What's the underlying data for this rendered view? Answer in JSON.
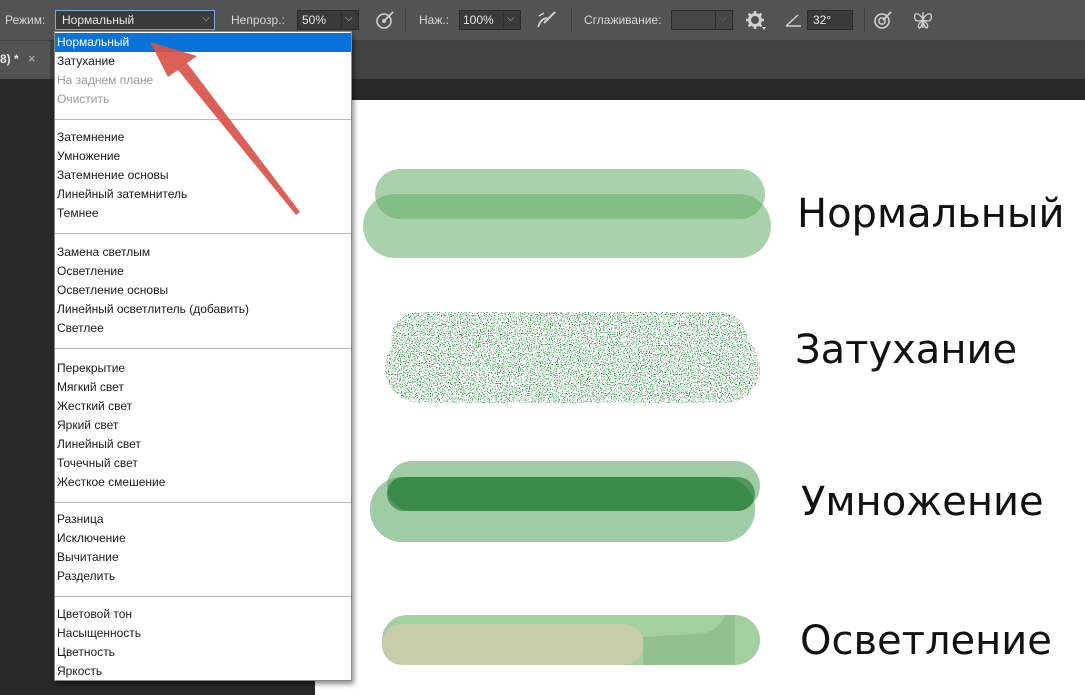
{
  "options_bar": {
    "mode_label": "Режим:",
    "mode_value": "Нормальный",
    "opacity_label": "Непрозр.:",
    "opacity_value": "50%",
    "pressure_label": "Наж.:",
    "pressure_value": "100%",
    "smoothing_label": "Сглаживание:",
    "smoothing_value": "",
    "angle_value": "32°"
  },
  "document_tab": {
    "title": "8) *",
    "close": "×"
  },
  "blend_menu": {
    "groups": [
      {
        "items": [
          {
            "label": "Нормальный",
            "state": "selected"
          },
          {
            "label": "Затухание",
            "state": "enabled"
          },
          {
            "label": "На заднем плане",
            "state": "disabled"
          },
          {
            "label": "Очистить",
            "state": "disabled"
          }
        ]
      },
      {
        "items": [
          {
            "label": "Затемнение"
          },
          {
            "label": "Умножение"
          },
          {
            "label": "Затемнение основы"
          },
          {
            "label": "Линейный затемнитель"
          },
          {
            "label": "Темнее"
          }
        ]
      },
      {
        "items": [
          {
            "label": "Замена светлым"
          },
          {
            "label": "Осветление"
          },
          {
            "label": "Осветление основы"
          },
          {
            "label": "Линейный осветлитель (добавить)"
          },
          {
            "label": "Светлее"
          }
        ]
      },
      {
        "items": [
          {
            "label": "Перекрытие"
          },
          {
            "label": "Мягкий свет"
          },
          {
            "label": "Жесткий свет"
          },
          {
            "label": "Яркий свет"
          },
          {
            "label": "Линейный свет"
          },
          {
            "label": "Точечный свет"
          },
          {
            "label": "Жесткое смешение"
          }
        ]
      },
      {
        "items": [
          {
            "label": "Разница"
          },
          {
            "label": "Исключение"
          },
          {
            "label": "Вычитание"
          },
          {
            "label": "Разделить"
          }
        ]
      },
      {
        "items": [
          {
            "label": "Цветовой тон"
          },
          {
            "label": "Насыщенность"
          },
          {
            "label": "Цветность"
          },
          {
            "label": "Яркость"
          }
        ]
      }
    ]
  },
  "canvas_labels": {
    "normal": "Нормальный",
    "dissolve": "Затухание",
    "multiply": "Умножение",
    "color_dodge": "Осветление"
  },
  "colors": {
    "selection": "#0a73d9",
    "stroke_green": "#62ad68",
    "annotation_arrow": "#d9534a"
  },
  "icons": [
    "airbrush-pressure-icon",
    "pressure-opacity-icon",
    "gear-icon",
    "angle-icon",
    "stylus-size-icon",
    "symmetry-butterfly-icon",
    "chevron-down-icon",
    "close-icon",
    "annotation-arrow"
  ]
}
